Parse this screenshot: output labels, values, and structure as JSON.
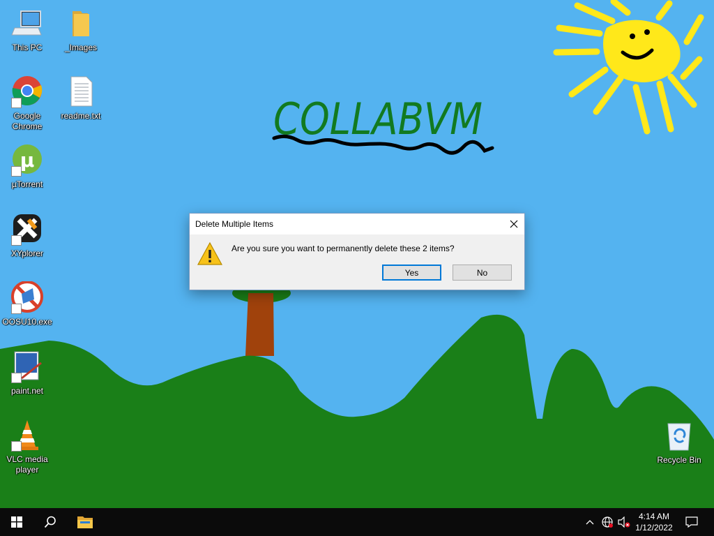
{
  "desktop": {
    "wallpaper_text": "COLLABVM",
    "icons": [
      {
        "label": "This PC",
        "icon": "computer-icon"
      },
      {
        "label": "_Images",
        "icon": "folder-icon"
      },
      {
        "label": "Google Chrome",
        "icon": "chrome-icon"
      },
      {
        "label": "readme.txt",
        "icon": "text-file-icon"
      },
      {
        "label": "µTorrent",
        "icon": "utorrent-icon"
      },
      {
        "label": "XYplorer",
        "icon": "xyplorer-icon"
      },
      {
        "label": "OOSU10.exe",
        "icon": "oosu10-icon"
      },
      {
        "label": "paint.net",
        "icon": "paintnet-icon"
      },
      {
        "label": "VLC media player",
        "icon": "vlc-icon"
      },
      {
        "label": "Recycle Bin",
        "icon": "recycle-bin-icon"
      }
    ]
  },
  "dialog": {
    "title": "Delete Multiple Items",
    "message": "Are you sure you want to permanently delete these 2 items?",
    "yes_label": "Yes",
    "no_label": "No",
    "icon": "warning-icon"
  },
  "taskbar": {
    "start": "windows-logo-icon",
    "search": "search-icon",
    "pinned": [
      "file-explorer-icon"
    ],
    "tray_icons": [
      "chevron-up-icon",
      "network-icon",
      "volume-muted-icon"
    ],
    "time": "4:14 AM",
    "date": "1/12/2022",
    "notifications": "action-center-icon"
  },
  "colors": {
    "sky": "#54b3f0",
    "hills": "#1a7f18",
    "taskbar": "#0b0b0b",
    "accent": "#0078d7"
  }
}
